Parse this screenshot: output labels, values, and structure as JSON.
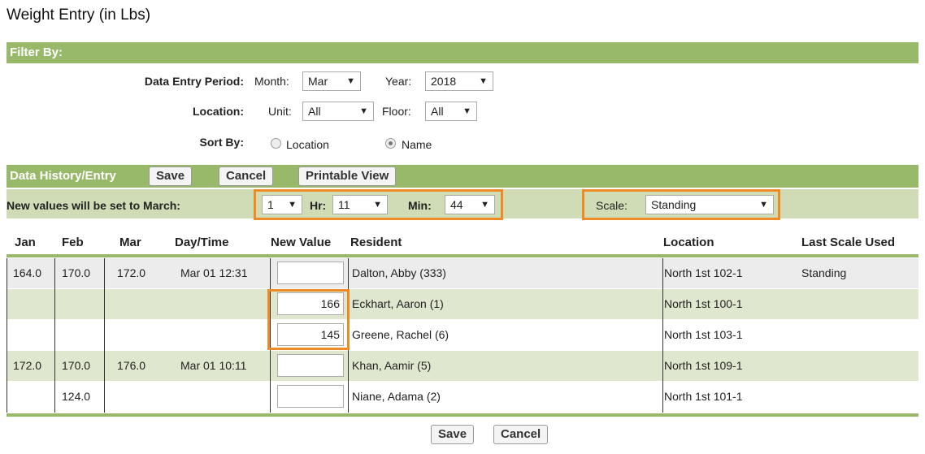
{
  "page": {
    "title": "Weight Entry (in Lbs)"
  },
  "filter": {
    "header": "Filter By:",
    "period_label": "Data Entry Period:",
    "month_label": "Month:",
    "month_value": "Mar",
    "year_label": "Year:",
    "year_value": "2018",
    "location_label": "Location:",
    "unit_label": "Unit:",
    "unit_value": "All",
    "floor_label": "Floor:",
    "floor_value": "All",
    "sort_label": "Sort By:",
    "sort_options": [
      "Location",
      "Name"
    ],
    "sort_selected": "Name"
  },
  "history": {
    "header": "Data History/Entry",
    "save_label": "Save",
    "cancel_label": "Cancel",
    "printable_label": "Printable View",
    "set_label": "New values will be set to March:",
    "day_value": "1",
    "hr_label": "Hr:",
    "hr_value": "11",
    "min_label": "Min:",
    "min_value": "44",
    "scale_label": "Scale:",
    "scale_value": "Standing"
  },
  "table": {
    "columns": [
      "Jan",
      "Feb",
      "Mar",
      "Day/Time",
      "New Value",
      "Resident",
      "Location",
      "Last Scale Used"
    ],
    "rows": [
      {
        "jan": "164.0",
        "feb": "170.0",
        "mar": "172.0",
        "daytime": "Mar 01 12:31",
        "new_value": "",
        "resident": "Dalton, Abby (333)",
        "location": "North 1st 102-1",
        "scale": "Standing"
      },
      {
        "jan": "",
        "feb": "",
        "mar": "",
        "daytime": "",
        "new_value": "166",
        "resident": "Eckhart, Aaron (1)",
        "location": "North 1st 100-1",
        "scale": ""
      },
      {
        "jan": "",
        "feb": "",
        "mar": "",
        "daytime": "",
        "new_value": "145",
        "resident": "Greene, Rachel (6)",
        "location": "North 1st 103-1",
        "scale": ""
      },
      {
        "jan": "172.0",
        "feb": "170.0",
        "mar": "176.0",
        "daytime": "Mar 01 10:11",
        "new_value": "",
        "resident": "Khan, Aamir (5)",
        "location": "North 1st 109-1",
        "scale": ""
      },
      {
        "jan": "",
        "feb": "124.0",
        "mar": "",
        "daytime": "",
        "new_value": "",
        "resident": "Niane, Adama (2)",
        "location": "North 1st 101-1",
        "scale": ""
      }
    ]
  },
  "footer": {
    "save_label": "Save",
    "cancel_label": "Cancel"
  },
  "colors": {
    "header_green": "#99b96a",
    "sub_green": "#cfdcb5",
    "highlight": "#f08a24"
  }
}
